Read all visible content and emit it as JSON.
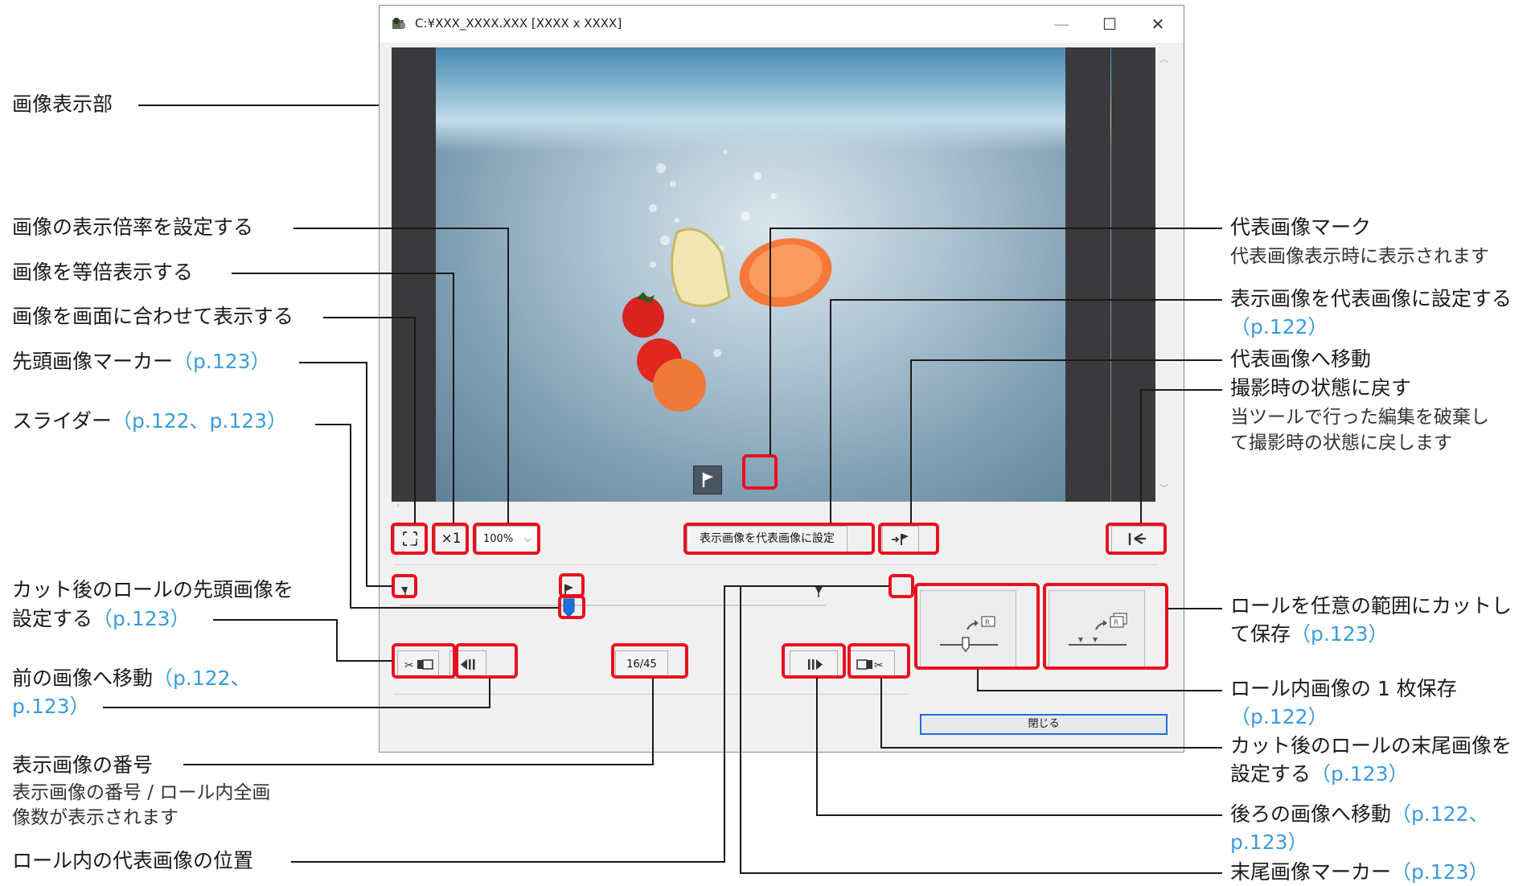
{
  "window": {
    "title": "C:¥XXX_XXXX.XXX [XXXX x XXXX]",
    "minimize_glyph": "—",
    "maximize_glyph": "☐",
    "close_glyph": "✕"
  },
  "toolbar": {
    "zoom_value": "100%",
    "actual_size_label": "×1",
    "set_representative_label": "表示画像を代表画像に設定",
    "frame_counter": "16/45",
    "close_label": "閉じる"
  },
  "icons": {
    "fit": "fit-to-screen-icon",
    "flag": "flag-icon",
    "goto_flag": "go-to-representative-icon",
    "revert": "revert-icon",
    "cut_start": "cut-start-icon",
    "prev": "previous-frame-icon",
    "next": "next-frame-icon",
    "cut_end": "cut-end-icon",
    "save_one": "save-single-frame-icon",
    "save_range": "save-range-icon"
  },
  "annotations_left": {
    "a1": "画像表示部",
    "a2": "画像の表示倍率を設定する",
    "a3": "画像を等倍表示する",
    "a4": "画像を画面に合わせて表示する",
    "a5": "先頭画像マーカー",
    "a5_ref": "（p.123）",
    "a6": "スライダー",
    "a6_ref": "（p.122、p.123）",
    "a7_line1": "カット後のロールの先頭画像を",
    "a7_line2": "設定する",
    "a7_ref": "（p.123）",
    "a8_line1": "前の画像へ移動",
    "a8_ref1": "（p.122、",
    "a8_ref2": "p.123）",
    "a9": "表示画像の番号",
    "a9_sub1": "表示画像の番号 / ロール内全画",
    "a9_sub2": "像数が表示されます",
    "a10": "ロール内の代表画像の位置"
  },
  "annotations_right": {
    "b1": "代表画像マーク",
    "b1_sub": "代表画像表示時に表示されます",
    "b2": "表示画像を代表画像に設定する",
    "b2_ref": "（p.122）",
    "b3": "代表画像へ移動",
    "b4": "撮影時の状態に戻す",
    "b4_sub1": "当ツールで行った編集を破棄し",
    "b4_sub2": "て撮影時の状態に戻します",
    "b5_line1": "ロールを任意の範囲にカットし",
    "b5_line2": "て保存",
    "b5_ref": "（p.123）",
    "b6": "ロール内画像の 1 枚保存",
    "b6_ref": "（p.122）",
    "b7_line1": "カット後のロールの末尾画像を",
    "b7_line2": "設定する",
    "b7_ref": "（p.123）",
    "b8": "後ろの画像へ移動",
    "b8_ref1": "（p.122、",
    "b8_ref2": "p.123）",
    "b9": "末尾画像マーカー",
    "b9_ref": "（p.123）"
  },
  "colors": {
    "highlight": "#e8101e",
    "reference": "#3a9be0",
    "slider_thumb": "#1e6fd9"
  }
}
